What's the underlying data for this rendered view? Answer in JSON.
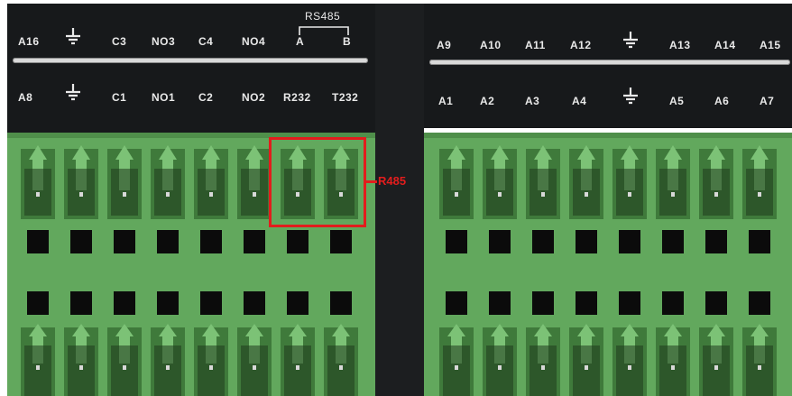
{
  "left_labels_top": [
    "A16",
    "C3",
    "NO3",
    "C4",
    "NO4",
    "A",
    "B"
  ],
  "left_labels_bottom": [
    "A8",
    "C1",
    "NO1",
    "C2",
    "NO2",
    "R232",
    "T232"
  ],
  "rs485_group": "RS485",
  "right_labels_top": [
    "A9",
    "A10",
    "A11",
    "A12",
    "A13",
    "A14",
    "A15"
  ],
  "right_labels_bottom": [
    "A1",
    "A2",
    "A3",
    "A4",
    "A5",
    "A6",
    "A7"
  ],
  "callout_label": "R485",
  "colors": {
    "panel": "#17191b",
    "terminal": "#62a85d",
    "highlight": "#e21d1d"
  }
}
